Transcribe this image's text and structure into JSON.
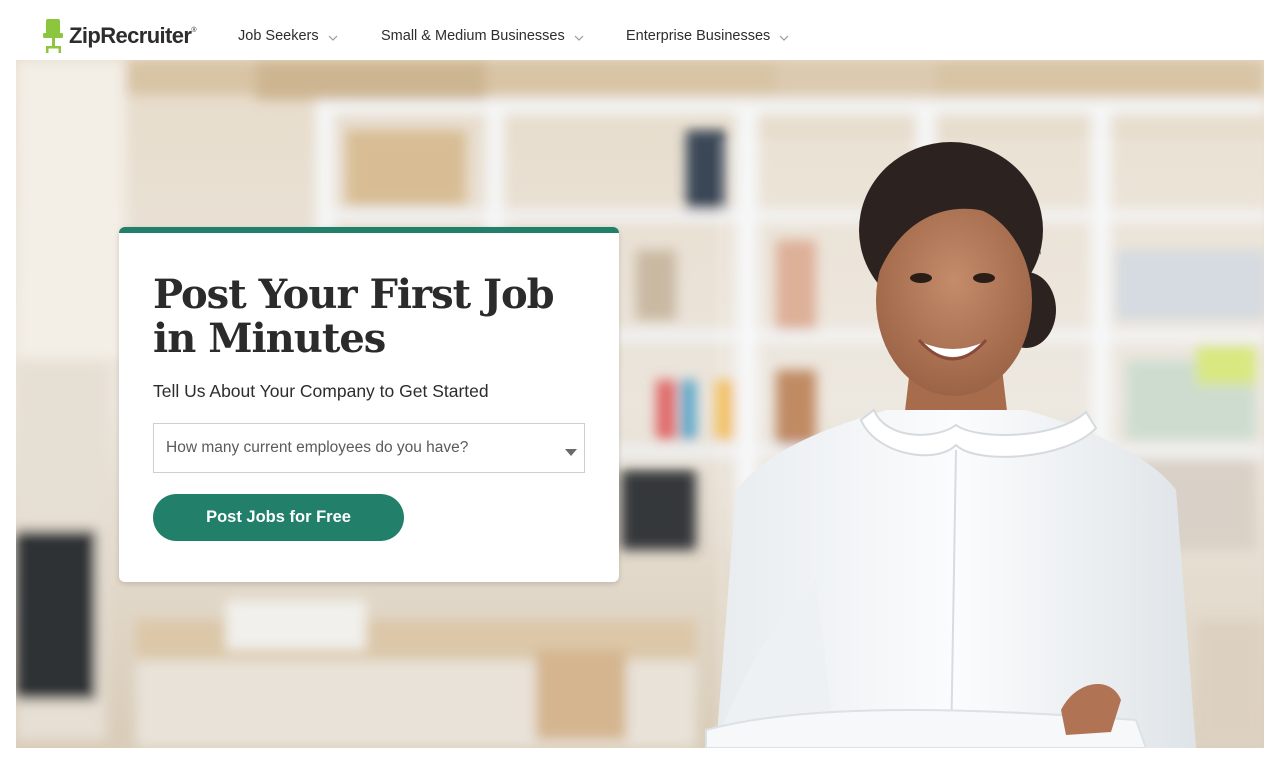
{
  "brand": {
    "name": "ZipRecruiter",
    "trademark": "®",
    "icon": "chair-icon",
    "icon_color": "#8cc63f"
  },
  "nav": {
    "items": [
      {
        "label": "Job Seekers",
        "icon": "chevron-down-icon"
      },
      {
        "label": "Small & Medium Businesses",
        "icon": "chevron-down-icon"
      },
      {
        "label": "Enterprise Businesses",
        "icon": "chevron-down-icon"
      }
    ]
  },
  "hero": {
    "image": "woman-office-photo"
  },
  "card": {
    "title": "Post Your First Job in Minutes",
    "subtitle": "Tell Us About Your Company to Get Started",
    "select_placeholder": "How many current employees do you have?",
    "cta_label": "Post Jobs for Free",
    "accent_color": "#22806a"
  }
}
